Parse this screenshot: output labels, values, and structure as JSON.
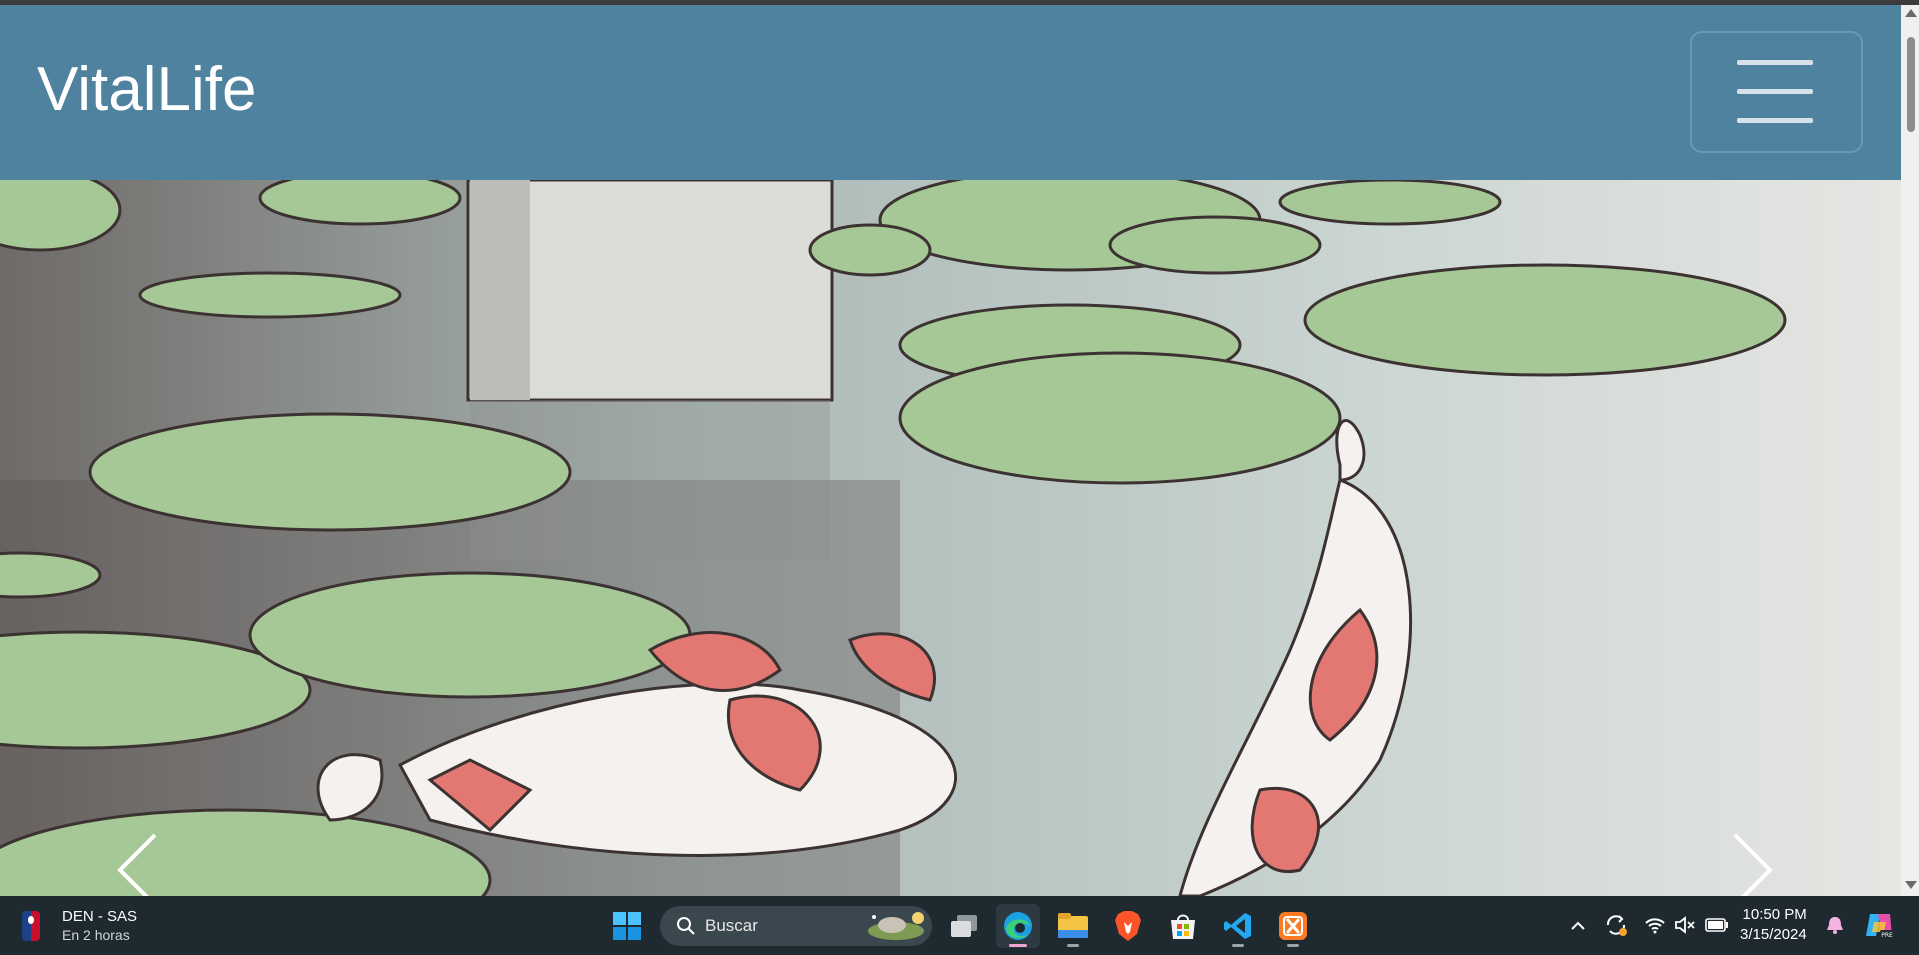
{
  "site": {
    "brand": "VitalLife"
  },
  "colors": {
    "navbar": "#4e829e",
    "taskbar": "#1f2a30",
    "water": "#c9d4d1",
    "lily_pad": "#a6c897",
    "koi_red": "#e37873"
  },
  "hero": {
    "image": "koi-pond-painting",
    "prev_icon": "chevron-left-icon",
    "next_icon": "chevron-right-icon"
  },
  "taskbar": {
    "weather_line1": "DEN - SAS",
    "weather_line2": "En 2 horas",
    "search_placeholder": "Buscar",
    "apps": [
      "windows-start-icon",
      "task-view-icon",
      "edge-icon",
      "file-explorer-icon",
      "brave-icon",
      "store-icon",
      "vscode-icon",
      "xampp-icon"
    ],
    "time": "10:50 PM",
    "date": "3/15/2024"
  }
}
